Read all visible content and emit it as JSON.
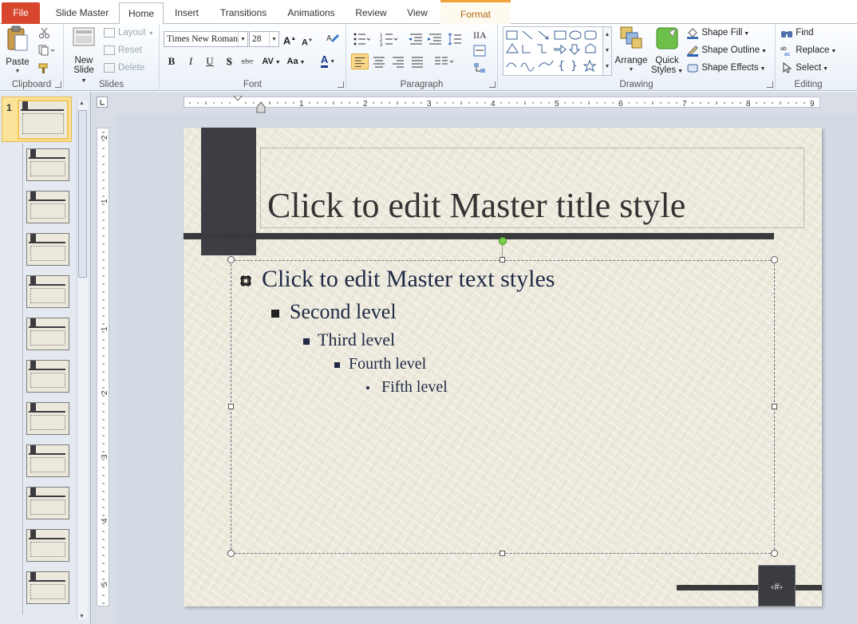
{
  "tabs": {
    "file": "File",
    "slide_master": "Slide Master",
    "home": "Home",
    "insert": "Insert",
    "transitions": "Transitions",
    "animations": "Animations",
    "review": "Review",
    "view": "View",
    "format": "Format"
  },
  "clipboard": {
    "label": "Clipboard",
    "paste": "Paste"
  },
  "slides_group": {
    "label": "Slides",
    "new_slide_1": "New",
    "new_slide_2": "Slide",
    "layout": "Layout",
    "reset": "Reset",
    "delete": "Delete"
  },
  "font_group": {
    "label": "Font",
    "font_name": "Times New Roman",
    "font_size": "28",
    "bold": "B",
    "italic": "I",
    "underline": "U",
    "shadow": "S",
    "strike": "abc",
    "spacing": "AV",
    "case": "Aa",
    "color": "A"
  },
  "paragraph_group": {
    "label": "Paragraph"
  },
  "drawing_group": {
    "label": "Drawing",
    "arrange": "Arrange",
    "quick_styles_1": "Quick",
    "quick_styles_2": "Styles",
    "shape_fill": "Shape Fill",
    "shape_outline": "Shape Outline",
    "shape_effects": "Shape Effects"
  },
  "editing_group": {
    "label": "Editing",
    "find": "Find",
    "replace": "Replace",
    "select": "Select"
  },
  "thumbnails": {
    "first_number": "1",
    "count": 12
  },
  "ruler": {
    "h_numbers": [
      "1",
      "2",
      "3",
      "4",
      "5",
      "6",
      "7",
      "8",
      "9"
    ],
    "v_numbers": [
      "2",
      "1",
      "1",
      "2",
      "3",
      "4",
      "5"
    ]
  },
  "slide": {
    "title": "Click to edit Master title style",
    "level1": "Click to edit Master text styles",
    "level2": "Second level",
    "level3": "Third level",
    "level4": "Fourth level",
    "level5": "Fifth level",
    "slide_number": "‹#›"
  },
  "colors": {
    "file_tab": "#d7462d",
    "context_tab": "#f0a23a",
    "slide_background": "#ece9dc",
    "dark_accent": "#3b3b42",
    "text_dark_blue": "#1f2a44"
  }
}
